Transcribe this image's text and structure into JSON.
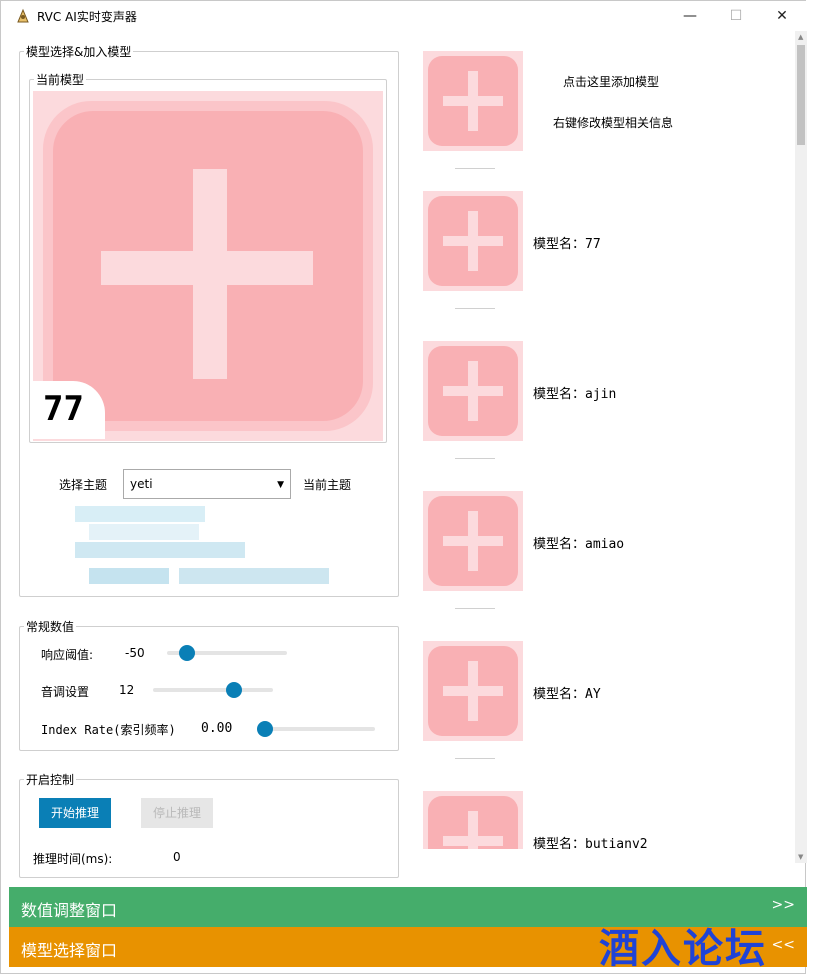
{
  "window": {
    "title": "RVC AI实时变声器",
    "minimize": "—",
    "maximize": "☐",
    "close": "✕"
  },
  "model_group": {
    "legend": "模型选择&加入模型",
    "current_legend": "当前模型",
    "badge": "77",
    "theme_label": "选择主题",
    "theme_value": "yeti",
    "current_theme_label": "当前主题"
  },
  "params": {
    "legend": "常规数值",
    "threshold_label": "响应阈值:",
    "threshold_value": "-50",
    "threshold_fraction": 0.12,
    "pitch_label": "音调设置",
    "pitch_value": "12",
    "pitch_fraction": 0.7,
    "index_label": "Index Rate(索引频率)",
    "index_value": "0.00",
    "index_fraction": 0.0
  },
  "control": {
    "legend": "开启控制",
    "start": "开始推理",
    "stop": "停止推理",
    "time_label": "推理时间(ms):",
    "time_value": "0"
  },
  "model_list": {
    "add_hint": "点击这里添加模型",
    "edit_hint": "右键修改模型相关信息",
    "models": [
      {
        "name": "模型名：77"
      },
      {
        "name": "模型名：ajin"
      },
      {
        "name": "模型名：amiao"
      },
      {
        "name": "模型名：AY"
      },
      {
        "name": "模型名：butianv2"
      }
    ]
  },
  "bottom_bars": {
    "green_label": "数值调整窗口",
    "green_arrow": ">>",
    "orange_label": "模型选择窗口",
    "orange_arrow": "<<"
  },
  "watermark": "酒入论坛",
  "colors": {
    "accent_blue": "#0a7fb6",
    "card_pink": "#f9b0b4",
    "card_light": "#fcdadd",
    "green_bar": "#45ad6b",
    "orange_bar": "#e89200",
    "watermark_blue": "#1f43d6"
  }
}
